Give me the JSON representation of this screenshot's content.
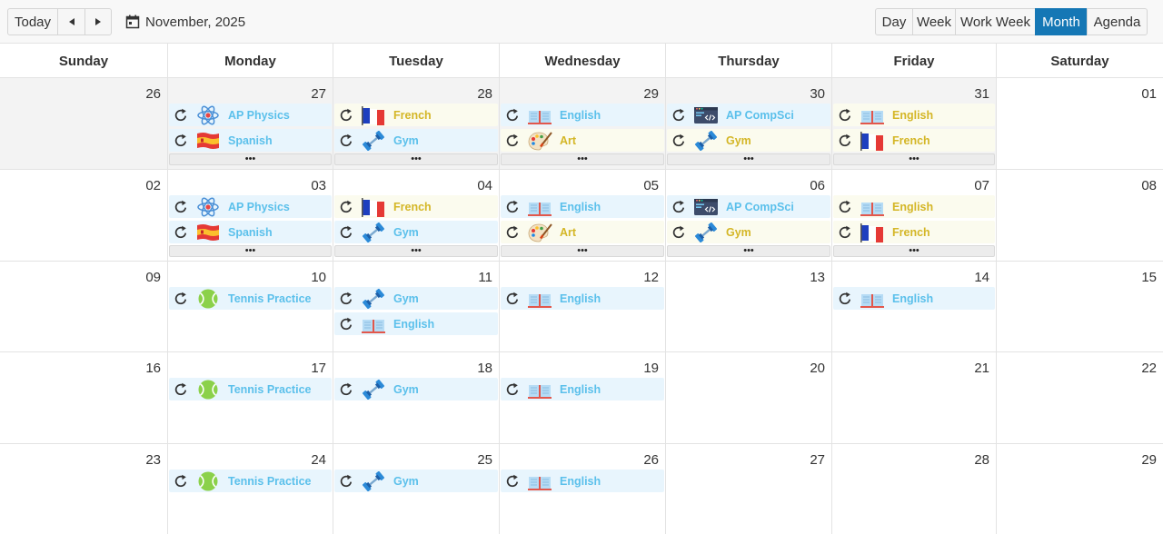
{
  "toolbar": {
    "today_label": "Today",
    "date_label": "November, 2025",
    "views": [
      {
        "label": "Day",
        "active": false
      },
      {
        "label": "Week",
        "active": false
      },
      {
        "label": "Work Week",
        "active": false
      },
      {
        "label": "Month",
        "active": true
      },
      {
        "label": "Agenda",
        "active": false
      }
    ]
  },
  "weekdays": [
    "Sunday",
    "Monday",
    "Tuesday",
    "Wednesday",
    "Thursday",
    "Friday",
    "Saturday"
  ],
  "colors": {
    "accent": "#1577b5",
    "event_blue_text": "#5bc0eb",
    "event_yellow_text": "#d4b626"
  },
  "weeks": [
    {
      "days": [
        {
          "num": "26",
          "past": true,
          "events": [],
          "more": false
        },
        {
          "num": "27",
          "past": true,
          "events": [
            {
              "title": "AP Physics",
              "icon": "atom-icon",
              "color": "blue"
            },
            {
              "title": "Spanish",
              "icon": "spain-flag-icon",
              "color": "blue"
            }
          ],
          "more": true
        },
        {
          "num": "28",
          "past": true,
          "events": [
            {
              "title": "French",
              "icon": "france-flag-icon",
              "color": "yellow"
            },
            {
              "title": "Gym",
              "icon": "dumbbell-icon",
              "color": "blue"
            }
          ],
          "more": true
        },
        {
          "num": "29",
          "past": true,
          "events": [
            {
              "title": "English",
              "icon": "book-icon",
              "color": "blue"
            },
            {
              "title": "Art",
              "icon": "palette-icon",
              "color": "yellow"
            }
          ],
          "more": true
        },
        {
          "num": "30",
          "past": true,
          "events": [
            {
              "title": "AP CompSci",
              "icon": "code-window-icon",
              "color": "blue"
            },
            {
              "title": "Gym",
              "icon": "dumbbell-icon",
              "color": "yellow"
            }
          ],
          "more": true
        },
        {
          "num": "31",
          "past": true,
          "events": [
            {
              "title": "English",
              "icon": "book-icon",
              "color": "yellow"
            },
            {
              "title": "French",
              "icon": "france-flag-icon",
              "color": "yellow"
            }
          ],
          "more": true
        },
        {
          "num": "01",
          "past": false,
          "events": [],
          "more": false
        }
      ]
    },
    {
      "days": [
        {
          "num": "02",
          "past": false,
          "events": [],
          "more": false
        },
        {
          "num": "03",
          "past": false,
          "events": [
            {
              "title": "AP Physics",
              "icon": "atom-icon",
              "color": "blue"
            },
            {
              "title": "Spanish",
              "icon": "spain-flag-icon",
              "color": "blue"
            }
          ],
          "more": true
        },
        {
          "num": "04",
          "past": false,
          "events": [
            {
              "title": "French",
              "icon": "france-flag-icon",
              "color": "yellow"
            },
            {
              "title": "Gym",
              "icon": "dumbbell-icon",
              "color": "blue"
            }
          ],
          "more": true
        },
        {
          "num": "05",
          "past": false,
          "events": [
            {
              "title": "English",
              "icon": "book-icon",
              "color": "blue"
            },
            {
              "title": "Art",
              "icon": "palette-icon",
              "color": "yellow"
            }
          ],
          "more": true
        },
        {
          "num": "06",
          "past": false,
          "events": [
            {
              "title": "AP CompSci",
              "icon": "code-window-icon",
              "color": "blue"
            },
            {
              "title": "Gym",
              "icon": "dumbbell-icon",
              "color": "yellow"
            }
          ],
          "more": true
        },
        {
          "num": "07",
          "past": false,
          "events": [
            {
              "title": "English",
              "icon": "book-icon",
              "color": "yellow"
            },
            {
              "title": "French",
              "icon": "france-flag-icon",
              "color": "yellow"
            }
          ],
          "more": true
        },
        {
          "num": "08",
          "past": false,
          "events": [],
          "more": false
        }
      ]
    },
    {
      "days": [
        {
          "num": "09",
          "past": false,
          "events": [],
          "more": false
        },
        {
          "num": "10",
          "past": false,
          "events": [
            {
              "title": "Tennis Practice",
              "icon": "tennis-ball-icon",
              "color": "blue"
            }
          ],
          "more": false
        },
        {
          "num": "11",
          "past": false,
          "events": [
            {
              "title": "Gym",
              "icon": "dumbbell-icon",
              "color": "blue"
            },
            {
              "title": "English",
              "icon": "book-icon",
              "color": "blue"
            }
          ],
          "more": false
        },
        {
          "num": "12",
          "past": false,
          "events": [
            {
              "title": "English",
              "icon": "book-icon",
              "color": "blue"
            }
          ],
          "more": false
        },
        {
          "num": "13",
          "past": false,
          "events": [],
          "more": false
        },
        {
          "num": "14",
          "past": false,
          "events": [
            {
              "title": "English",
              "icon": "book-icon",
              "color": "blue"
            }
          ],
          "more": false
        },
        {
          "num": "15",
          "past": false,
          "events": [],
          "more": false
        }
      ]
    },
    {
      "days": [
        {
          "num": "16",
          "past": false,
          "events": [],
          "more": false
        },
        {
          "num": "17",
          "past": false,
          "events": [
            {
              "title": "Tennis Practice",
              "icon": "tennis-ball-icon",
              "color": "blue"
            }
          ],
          "more": false
        },
        {
          "num": "18",
          "past": false,
          "events": [
            {
              "title": "Gym",
              "icon": "dumbbell-icon",
              "color": "blue"
            }
          ],
          "more": false
        },
        {
          "num": "19",
          "past": false,
          "events": [
            {
              "title": "English",
              "icon": "book-icon",
              "color": "blue"
            }
          ],
          "more": false
        },
        {
          "num": "20",
          "past": false,
          "events": [],
          "more": false
        },
        {
          "num": "21",
          "past": false,
          "events": [],
          "more": false
        },
        {
          "num": "22",
          "past": false,
          "events": [],
          "more": false
        }
      ]
    },
    {
      "days": [
        {
          "num": "23",
          "past": false,
          "events": [],
          "more": false
        },
        {
          "num": "24",
          "past": false,
          "events": [
            {
              "title": "Tennis Practice",
              "icon": "tennis-ball-icon",
              "color": "blue"
            }
          ],
          "more": false
        },
        {
          "num": "25",
          "past": false,
          "events": [
            {
              "title": "Gym",
              "icon": "dumbbell-icon",
              "color": "blue"
            }
          ],
          "more": false
        },
        {
          "num": "26",
          "past": false,
          "events": [
            {
              "title": "English",
              "icon": "book-icon",
              "color": "blue"
            }
          ],
          "more": false
        },
        {
          "num": "27",
          "past": false,
          "events": [],
          "more": false
        },
        {
          "num": "28",
          "past": false,
          "events": [],
          "more": false
        },
        {
          "num": "29",
          "past": false,
          "events": [],
          "more": false
        }
      ]
    }
  ]
}
